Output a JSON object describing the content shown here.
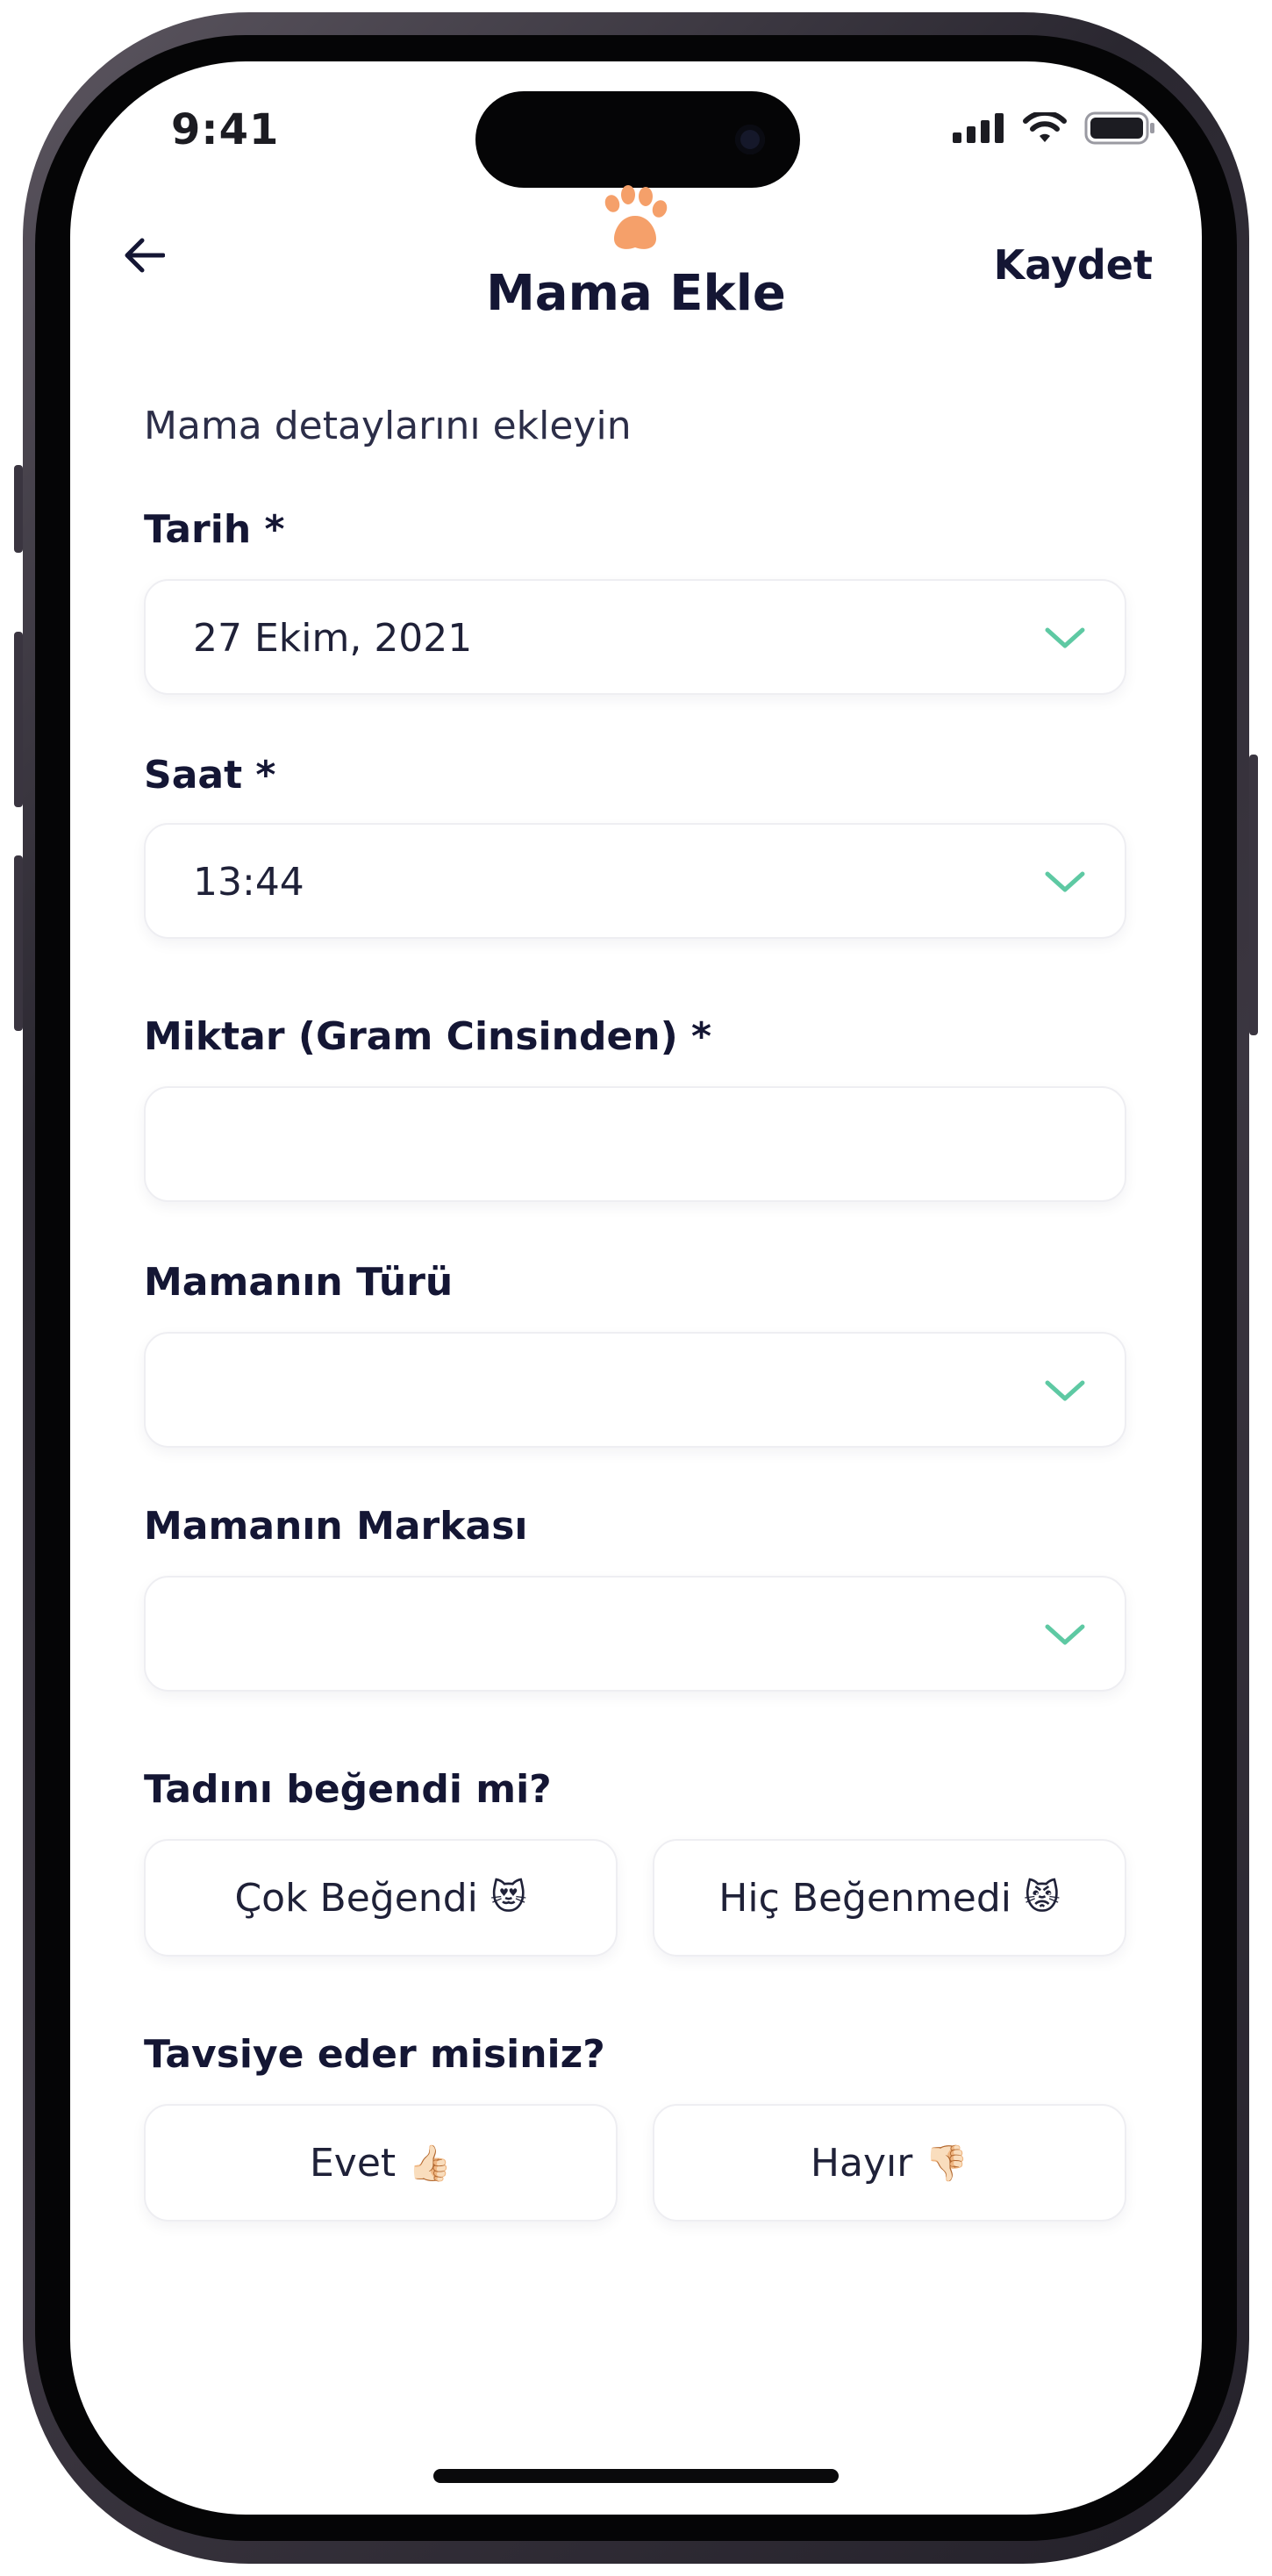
{
  "status_bar": {
    "time": "9:41"
  },
  "header": {
    "back_icon": "arrow-left-icon",
    "logo_icon": "paw-icon",
    "title": "Mama Ekle",
    "save_label": "Kaydet"
  },
  "form": {
    "subtitle": "Mama detaylarını ekleyin",
    "date": {
      "label": "Tarih *",
      "value": "27 Ekim, 2021"
    },
    "time": {
      "label": "Saat *",
      "value": "13:44"
    },
    "amount": {
      "label": "Miktar (Gram Cinsinden) *",
      "value": ""
    },
    "food_type": {
      "label": "Mamanın Türü",
      "value": ""
    },
    "food_brand": {
      "label": "Mamanın Markası",
      "value": ""
    },
    "taste": {
      "label": "Tadını beğendi mi?",
      "options": [
        {
          "label": "Çok Beğendi",
          "emoji": "😻"
        },
        {
          "label": "Hiç Beğenmedi",
          "emoji": "😾"
        }
      ]
    },
    "recommend": {
      "label": "Tavsiye eder misiniz?",
      "options": [
        {
          "label": "Evet",
          "emoji": "👍🏻"
        },
        {
          "label": "Hayır",
          "emoji": "👎🏻"
        }
      ]
    }
  },
  "colors": {
    "primary_text": "#141634",
    "accent_chevron": "#5ec9a3",
    "paw": "#f5a06a"
  }
}
